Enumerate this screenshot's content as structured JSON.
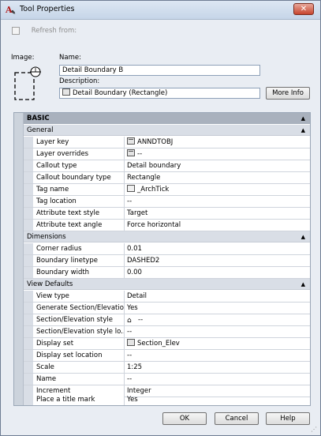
{
  "window": {
    "title": "Tool Properties",
    "close_glyph": "✕"
  },
  "refresh": {
    "label": "Refresh from:",
    "checked": false
  },
  "image": {
    "label": "Image:"
  },
  "name": {
    "label": "Name:",
    "value": "Detail Boundary B"
  },
  "description": {
    "label": "Description:",
    "value": "Detail Boundary (Rectangle)"
  },
  "more_info_label": "More Info",
  "categories": {
    "basic": "BASIC",
    "general": "General",
    "dimensions": "Dimensions",
    "view_defaults": "View Defaults"
  },
  "general": [
    {
      "key": "Layer key",
      "value": "ANNDTOBJ",
      "icon": "layer-key-icon"
    },
    {
      "key": "Layer overrides",
      "value": "--",
      "icon": "layer-overrides-icon"
    },
    {
      "key": "Callout type",
      "value": "Detail boundary"
    },
    {
      "key": "Callout boundary type",
      "value": "Rectangle"
    },
    {
      "key": "Tag name",
      "value": "_ArchTick",
      "icon": "tag-icon"
    },
    {
      "key": "Tag location",
      "value": "--"
    },
    {
      "key": "Attribute text style",
      "value": "Target"
    },
    {
      "key": "Attribute text angle",
      "value": "Force horizontal"
    }
  ],
  "dimensions": [
    {
      "key": "Corner radius",
      "value": "0.01"
    },
    {
      "key": "Boundary linetype",
      "value": "DASHED2"
    },
    {
      "key": "Boundary width",
      "value": "0.00"
    }
  ],
  "view_defaults": [
    {
      "key": "View type",
      "value": "Detail"
    },
    {
      "key": "Generate Section/Elevation",
      "value": "Yes"
    },
    {
      "key": "Section/Elevation style",
      "value": "--",
      "icon": "style-icon"
    },
    {
      "key": "Section/Elevation style lo...",
      "value": "--"
    },
    {
      "key": "Display set",
      "value": "Section_Elev",
      "icon": "display-set-icon"
    },
    {
      "key": "Display set location",
      "value": "--"
    },
    {
      "key": "Scale",
      "value": "1:25"
    },
    {
      "key": "Name",
      "value": "--"
    },
    {
      "key": "Increment",
      "value": "Integer"
    },
    {
      "key": "Place a title mark",
      "value": "Yes"
    }
  ],
  "buttons": {
    "ok": "OK",
    "cancel": "Cancel",
    "help": "Help"
  },
  "colors": {
    "category_bg": "#d9dee6",
    "basic_bg": "#a9b1bd",
    "window_bg": "#e9edf3"
  }
}
